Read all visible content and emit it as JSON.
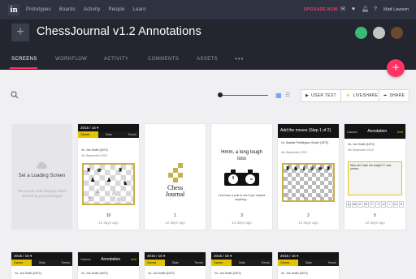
{
  "nav": {
    "items": [
      "Prototypes",
      "Boards",
      "Activity",
      "People",
      "Learn"
    ],
    "upgrade_label": "UPGRADE NOW",
    "user_name": "Matt Lawson"
  },
  "project": {
    "title": "ChessJournal v1.2 Annotations",
    "add_label": "+"
  },
  "tabs": {
    "screens": "SCREENS",
    "workflow": "WORKFLOW",
    "activity": "ACTIVITY",
    "comments": "COMMENTS",
    "assets": "ASSETS",
    "more": "•••"
  },
  "fab_label": "+",
  "toolbar": {
    "user_test": "USER TEST",
    "liveshare": "LIVESHARE",
    "share": "SHARE"
  },
  "screens": [
    {
      "empty_title": "Set a Loading Screen",
      "empty_sub": "The screen that displays when launching your prototype"
    },
    {
      "header": "2015 / 16 ▾",
      "sub": [
        "Games",
        "Stats",
        "Trends"
      ],
      "players": "Vs. Joe Smith (1872)",
      "date": "4th September 2015",
      "number": "10",
      "time": "12 days ago"
    },
    {
      "logo_line1": "Chess",
      "logo_line2": "Journal",
      "number": "1",
      "time": "12 days ago"
    },
    {
      "message": "Hmm, a long tough loss",
      "footnote": "Lets have a look to see if you missed anything...",
      "number": "3",
      "time": "12 days ago"
    },
    {
      "header": "Add the moves (Step 1 of 2)",
      "players": "Vs. Alastair Peddington Smyth (1872)",
      "date": "4th September 2015",
      "number": "2",
      "time": "12 days ago"
    },
    {
      "cancel": "Cancel",
      "title": "Annotation",
      "add": "Add",
      "players": "Vs. Joe Smith (1872)",
      "date": "4th September 2015",
      "note": "Why did I take the knight?! I was pressu",
      "keys": [
        "Q",
        "W",
        "E",
        "R",
        "T",
        "Y",
        "U",
        "I",
        "O",
        "P"
      ],
      "number": "5",
      "time": "12 days ago"
    }
  ],
  "row2": [
    {
      "header": "2015 / 16 ▾",
      "sub": [
        "Games",
        "Stats",
        "Trends"
      ],
      "players": "Vs. Joe Smith (1872)"
    },
    {
      "cancel": "Cancel",
      "title": "Annotation",
      "add": "Add",
      "players": "Vs. Joe Smith (1872)"
    },
    {
      "header": "2015 / 16 ▾",
      "sub": [
        "Games",
        "Stats",
        "Trends"
      ],
      "players": "Vs. Joe Smith (1872)"
    },
    {
      "header": "2015 / 16 ▾",
      "sub": [
        "Games",
        "Stats",
        "Trends"
      ],
      "players": "Vs. Joe Smith (1872)"
    },
    {
      "header": "2015 / 16 ▾",
      "sub": [
        "Games",
        "Stats",
        "Trends"
      ],
      "players": "Vs. Joe Smith (1872)"
    }
  ],
  "colors": {
    "accent": "#ff3366",
    "highlight": "#e4c400",
    "dark": "#24262f",
    "topbar": "#2f3240"
  }
}
